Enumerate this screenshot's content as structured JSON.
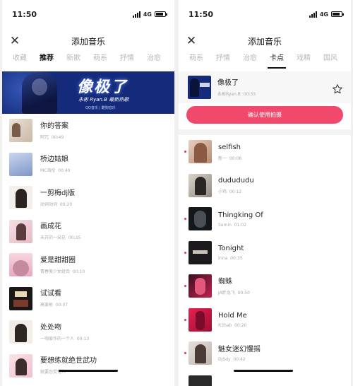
{
  "left": {
    "status": {
      "time": "11:50",
      "network": "4G"
    },
    "header": {
      "title": "添加音乐"
    },
    "tabs": [
      {
        "label": "收藏"
      },
      {
        "label": "推荐"
      },
      {
        "label": "新歌"
      },
      {
        "label": "萌系"
      },
      {
        "label": "抒情"
      },
      {
        "label": "治愈"
      }
    ],
    "banner": {
      "title": "像极了",
      "subtitle": "永彬 Ryan.B 最新热歌",
      "small": "QQ音乐 | 酷狗音乐"
    },
    "songs": [
      {
        "title": "你的答案",
        "artist": "阿冗",
        "duration": "00:49"
      },
      {
        "title": "桥边姑娘",
        "artist": "MC海伦",
        "duration": "00:40"
      },
      {
        "title": "一剪梅dj版",
        "artist": "动词动词",
        "duration": "00:20"
      },
      {
        "title": "画成花",
        "artist": "未开的一朵花",
        "duration": "00:35"
      },
      {
        "title": "爱是甜甜圈",
        "artist": "青春美少女组合",
        "duration": "00:10"
      },
      {
        "title": "试试看",
        "artist": "高爱彬",
        "duration": "00:07"
      },
      {
        "title": "处处吻",
        "artist": "一嗨爱作的一个人",
        "duration": "00:13"
      },
      {
        "title": "要想练就绝世武功",
        "artist": "就要忍受常人",
        "duration": ""
      }
    ]
  },
  "right": {
    "status": {
      "time": "11:50",
      "network": "4G"
    },
    "header": {
      "title": "添加音乐"
    },
    "tabs": [
      {
        "label": "萌系"
      },
      {
        "label": "抒情"
      },
      {
        "label": "治愈"
      },
      {
        "label": "卡点"
      },
      {
        "label": "戏精"
      },
      {
        "label": "国风"
      }
    ],
    "selected": {
      "title": "像极了",
      "artist": "永彬Ryan.B",
      "duration": "00:33"
    },
    "confirm_label": "确认使用拍摄",
    "songs": [
      {
        "title": "selfish",
        "artist": "新一",
        "duration": "00:08"
      },
      {
        "title": "dudududu",
        "artist": "小鸡",
        "duration": "00:12"
      },
      {
        "title": "Thingking Of",
        "artist": "Sumin",
        "duration": "01:02"
      },
      {
        "title": "Tonight",
        "artist": "Irina",
        "duration": "00:35"
      },
      {
        "title": "蜘蛛",
        "artist": "JA胖龙飞",
        "duration": "00:50"
      },
      {
        "title": "Hold Me",
        "artist": "R3hab",
        "duration": "00:20"
      },
      {
        "title": "魅女迷幻慢摇",
        "artist": "DJSdy",
        "duration": "00:42"
      },
      {
        "title": "",
        "artist": "",
        "duration": ""
      }
    ]
  },
  "colors": {
    "accent": "#f0496b",
    "dot": "#e63462",
    "banner": "#142a7a"
  }
}
